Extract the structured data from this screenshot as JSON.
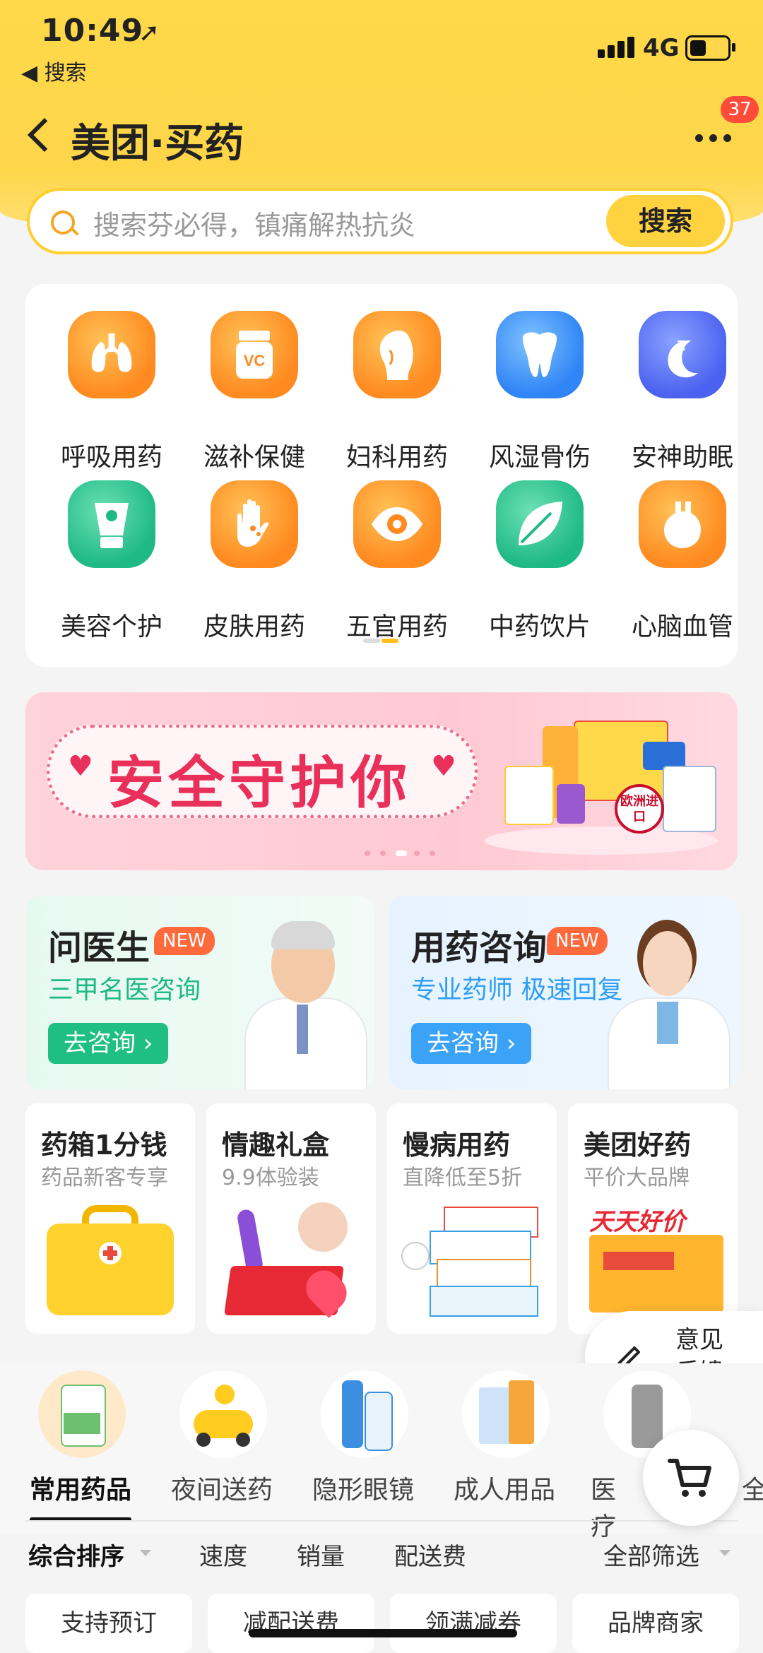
{
  "status_bar": {
    "time": "10:49",
    "back_app": "◀ 搜索",
    "network": "4G"
  },
  "nav": {
    "title": "美团·买药",
    "badge": "37"
  },
  "search": {
    "placeholder": "搜索芬必得，镇痛解热抗炎",
    "button": "搜索"
  },
  "categories": [
    {
      "label": "呼吸用药",
      "icon": "lungs-icon",
      "color": "#ff8a1f"
    },
    {
      "label": "滋补保健",
      "icon": "vitamin-bottle-icon",
      "color": "#ff8a1f"
    },
    {
      "label": "妇科用药",
      "icon": "woman-profile-icon",
      "color": "#ff8a1f"
    },
    {
      "label": "风湿骨伤",
      "icon": "tooth-bone-icon",
      "color": "#2f84f6"
    },
    {
      "label": "安神助眠",
      "icon": "moon-sleep-icon",
      "color": "#4b62f1"
    },
    {
      "label": "美容个护",
      "icon": "cosmetic-tube-icon",
      "color": "#1fb986"
    },
    {
      "label": "皮肤用药",
      "icon": "hand-icon",
      "color": "#ff8a1f"
    },
    {
      "label": "五官用药",
      "icon": "eye-icon",
      "color": "#ff8a1f"
    },
    {
      "label": "中药饮片",
      "icon": "leaf-icon",
      "color": "#1fb986"
    },
    {
      "label": "心脑血管",
      "icon": "heart-organ-icon",
      "color": "#ff8a1f"
    }
  ],
  "banner": {
    "text": "安全守护你",
    "stamp": "欧洲进口"
  },
  "consult": [
    {
      "title": "问医生",
      "tag": "NEW",
      "subtitle": "三甲名医咨询",
      "button": "去咨询 ›"
    },
    {
      "title": "用药咨询",
      "tag": "NEW",
      "subtitle": "专业药师 极速回复",
      "button": "去咨询 ›"
    }
  ],
  "promos": [
    {
      "title": "药箱1分钱",
      "subtitle": "药品新客专享"
    },
    {
      "title": "情趣礼盒",
      "subtitle": "9.9体验装"
    },
    {
      "title": "慢病用药",
      "subtitle": "直降低至5折"
    },
    {
      "title": "美团好药",
      "subtitle": "平价大品牌",
      "art_text": "天天好价"
    }
  ],
  "feedback": {
    "label": "意见反馈"
  },
  "tabs": [
    {
      "label": "常用药品",
      "active": true
    },
    {
      "label": "夜间送药"
    },
    {
      "label": "隐形眼镜"
    },
    {
      "label": "成人用品"
    },
    {
      "label": "医疗"
    },
    {
      "label": "全"
    }
  ],
  "sort": {
    "comprehensive": "综合排序",
    "speed": "速度",
    "sales": "销量",
    "delivery_fee": "配送费",
    "filter_all": "全部筛选"
  },
  "filters": [
    "支持预订",
    "减配送费",
    "领满减券",
    "品牌商家"
  ],
  "colors": {
    "brand_yellow": "#ffd23f",
    "accent_red": "#ff4b3a",
    "teal_text": "#1fb986",
    "blue_text": "#2f84f6"
  }
}
